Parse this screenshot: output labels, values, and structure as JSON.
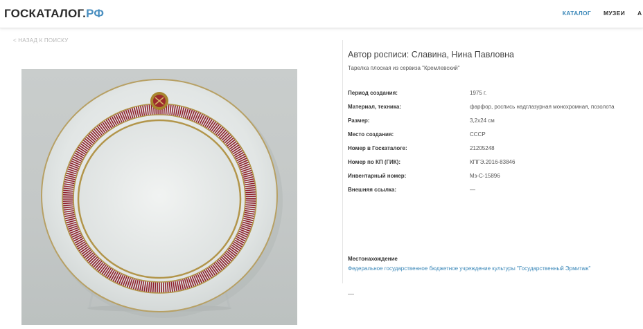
{
  "header": {
    "logo_main": "ГОСКАТАЛОГ.",
    "logo_suffix": "РФ",
    "nav": [
      {
        "label": "КАТАЛОГ"
      },
      {
        "label": "МУЗЕИ"
      },
      {
        "label": "А"
      }
    ],
    "accent_color": "#3a87b8"
  },
  "back_link": "< НАЗАД К ПОИСКУ",
  "item": {
    "title": "Автор росписи: Славина, Нина Павловна",
    "subtitle": "Тарелка плоская из сервиза \"Кремлевский\"",
    "properties": [
      {
        "label": "Период создания:",
        "value": "1975 г."
      },
      {
        "label": "Материал, техника:",
        "value": "фарфор, роспись надглазурная монохромная, позолота"
      },
      {
        "label": "Размер:",
        "value": "3,2x24 см"
      },
      {
        "label": "Место создания:",
        "value": "СССР"
      },
      {
        "label": "Номер в Госкаталоге:",
        "value": "21205248"
      },
      {
        "label": "Номер по КП (ГИК):",
        "value": "КПГЭ.2016-83846"
      },
      {
        "label": "Инвентарный номер:",
        "value": "Мз-С-15896"
      },
      {
        "label": "Внешняя ссылка:",
        "value": "—"
      }
    ],
    "location_label": "Местонахождение",
    "location_value": "Федеральное государственное бюджетное учреждение культуры \"Государственный Эрмитаж\"",
    "trailing": "—"
  }
}
